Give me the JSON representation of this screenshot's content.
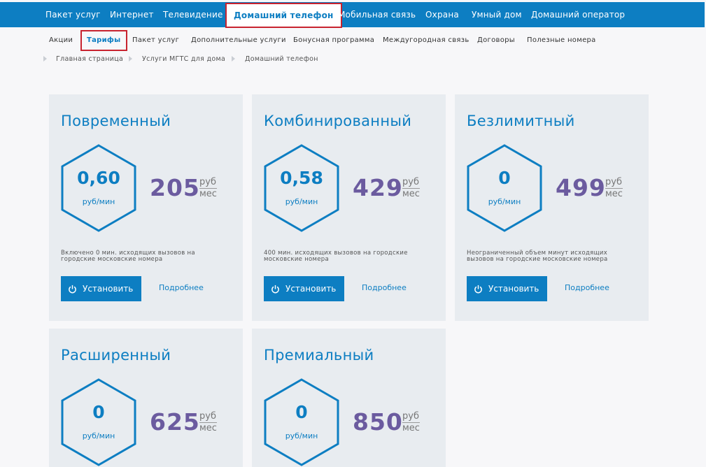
{
  "top_nav": [
    "Пакет услуг",
    "Интернет",
    "Телевидение",
    "Домашний телефон",
    "Мобильная связь",
    "Охрана",
    "Умный дом",
    "Домашний оператор"
  ],
  "sub_nav": [
    "Акции",
    "Тарифы",
    "Пакет услуг",
    "Дополнительные услуги",
    "Бонусная программа",
    "Междугородная связь",
    "Договоры",
    "Полезные номера"
  ],
  "breadcrumb": [
    "Главная страница",
    "Услуги МГТС для дома",
    "Домашний телефон"
  ],
  "labels": {
    "install": "Установить",
    "more": "Подробнее",
    "rate_unit": "руб/мин",
    "rub": "руб",
    "mes": "мес"
  },
  "tariffs": [
    {
      "name": "Повременный",
      "rate": "0,60",
      "price": "205",
      "desc": "Включено  0 мин. исходящих вызовов на городские московские номера"
    },
    {
      "name": "Комбинированный",
      "rate": "0,58",
      "price": "429",
      "desc": "400 мин. исходящих вызовов на городские московские номера"
    },
    {
      "name": "Безлимитный",
      "rate": "0",
      "price": "499",
      "desc": "Неограниченный объем минут исходящих вызовов на городские московские номера"
    },
    {
      "name": "Расширенный",
      "rate": "0",
      "price": "625",
      "desc": ""
    },
    {
      "name": "Премиальный",
      "rate": "0",
      "price": "850",
      "desc": ""
    }
  ],
  "colors": {
    "brand": "#0d7ec2",
    "price": "#6b5b9f",
    "highlight": "#c8232f"
  }
}
